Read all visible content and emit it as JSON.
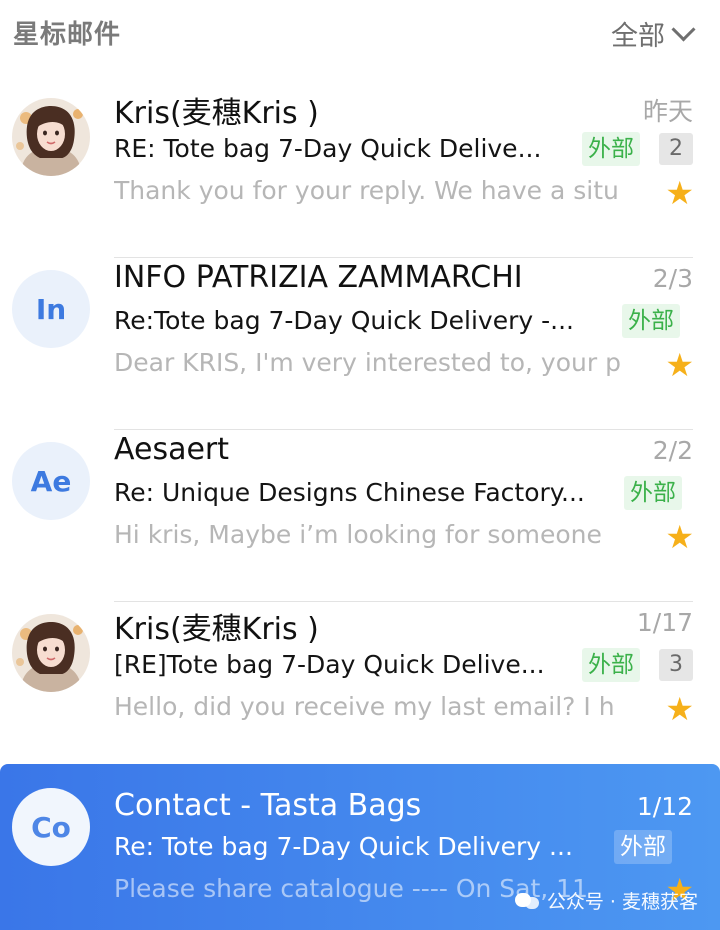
{
  "header": {
    "title": "星标邮件",
    "filter_label": "全部"
  },
  "mails": [
    {
      "avatar_initials": "",
      "sender": "Kris(麦穗Kris )",
      "date": "昨天",
      "subject": "RE: Tote bag 7-Day Quick Delive...",
      "tag": "外部",
      "count": "2",
      "preview": "Thank you for your reply. We have a situ",
      "star": "★",
      "selected": false
    },
    {
      "avatar_initials": "In",
      "sender": "INFO PATRIZIA ZAMMARCHI",
      "date": "2/3",
      "subject": "Re:Tote bag 7-Day Quick Delivery -...",
      "tag": "外部",
      "count": "",
      "preview": "Dear KRIS, I'm very interested to, your p",
      "star": "★",
      "selected": false
    },
    {
      "avatar_initials": "Ae",
      "sender": "Aesaert",
      "date": "2/2",
      "subject": "Re: Unique Designs Chinese Factory...",
      "tag": "外部",
      "count": "",
      "preview": "Hi kris, Maybe i’m looking for someone",
      "star": "★",
      "selected": false
    },
    {
      "avatar_initials": "",
      "sender": "Kris(麦穗Kris )",
      "date": "1/17",
      "subject": "[RE]Tote bag 7-Day Quick Delive...",
      "tag": "外部",
      "count": "3",
      "preview": "Hello, did you receive my last email? I h",
      "star": "★",
      "selected": false
    },
    {
      "avatar_initials": "Co",
      "sender": "Contact - Tasta Bags",
      "date": "1/12",
      "subject": "Re: Tote bag 7-Day Quick Delivery ...",
      "tag": "外部",
      "count": "",
      "preview": "Please share catalogue ---- On Sat, 11",
      "star": "★",
      "selected": true
    }
  ],
  "watermark": {
    "text": "公众号 · 麦穗获客"
  },
  "colors": {
    "selected_bg": "#3a76e8",
    "tag_green": "#3bb14a",
    "star": "#f6b01a"
  }
}
